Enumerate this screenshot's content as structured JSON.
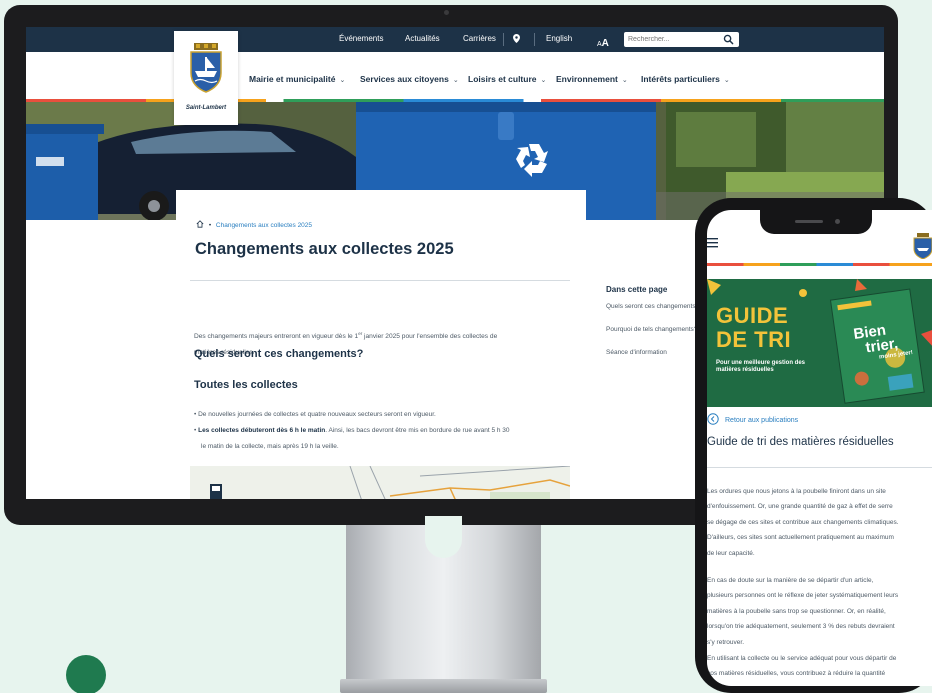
{
  "colors": {
    "navy": "#1d3247",
    "link_blue": "#2a7fc0",
    "background_mint": "#e7f4ee",
    "banner_green": "#1f6b43",
    "banner_yellow": "#f3c33a"
  },
  "topbar": {
    "links": [
      "Événements",
      "Actualités",
      "Carrières"
    ],
    "location_icon": "map-pin-icon",
    "language": "English",
    "text_size_small": "A",
    "text_size_large": "A",
    "search_placeholder": "Rechercher...",
    "search_icon": "search-icon"
  },
  "logo": {
    "text": "Saint-Lambert"
  },
  "nav": {
    "items": [
      {
        "label": "Mairie et municipalité"
      },
      {
        "label": "Services aux citoyens"
      },
      {
        "label": "Loisirs et culture"
      },
      {
        "label": "Environnement"
      },
      {
        "label": "Intérêts particuliers"
      }
    ],
    "chevron": "⌄"
  },
  "article": {
    "breadcrumb_current": "Changements aux collectes 2025",
    "title": "Changements aux collectes 2025",
    "intro_line1_pre": "Des changements majeurs entreront en vigueur dès le 1",
    "intro_sup": "er",
    "intro_line1_post": " janvier 2025 pour l'ensemble des collectes de",
    "intro_line2": "matières résiduelles.",
    "h2": "Quels seront ces changements?",
    "h3": "Toutes les collectes",
    "bullet1": "De nouvelles journées de collectes et quatre nouveaux secteurs seront en vigueur.",
    "bullet2_bold": "Les collectes débuteront dès 6 h le matin",
    "bullet2_rest": ". Ainsi, les bacs devront être mis en bordure de rue avant 5 h 30",
    "bullet2_line2": "le matin de la collecte, mais après 19 h la veille."
  },
  "sidebar": {
    "title": "Dans cette page",
    "links": [
      "Quels seront ces changements?",
      "Pourquoi de tels changements?",
      "Séance d'information"
    ]
  },
  "phone": {
    "banner_line1": "GUIDE",
    "banner_line2": "DE TRI",
    "banner_sub": "Pour une meilleure gestion des matières résiduelles",
    "book_text1": "Bien",
    "book_text2": "trier,",
    "book_text3": "moins jeter!",
    "back_link": "Retour aux publications",
    "title": "Guide de tri des matières résiduelles",
    "para1": [
      "Les ordures que nous jetons à la poubelle finiront dans un site",
      "d'enfouissement. Or, une grande quantité de gaz à effet de serre",
      "se dégage de ces sites et contribue aux changements climatiques.",
      "D'ailleurs, ces sites sont actuellement pratiquement au maximum",
      "de leur capacité."
    ],
    "para2": [
      "En cas de doute sur la manière de se départir d'un article,",
      "plusieurs personnes ont le réflexe de jeter systématiquement leurs",
      "matières à la poubelle sans trop se questionner. Or, en réalité,",
      "lorsqu'on trie adéquatement, seulement 3 % des rebuts devraient",
      "s'y retrouver."
    ],
    "para3": [
      "En utilisant la collecte ou le service adéquat pour vous départir de",
      "vos matières résiduelles, vous contribuez à réduire la quantité"
    ]
  }
}
